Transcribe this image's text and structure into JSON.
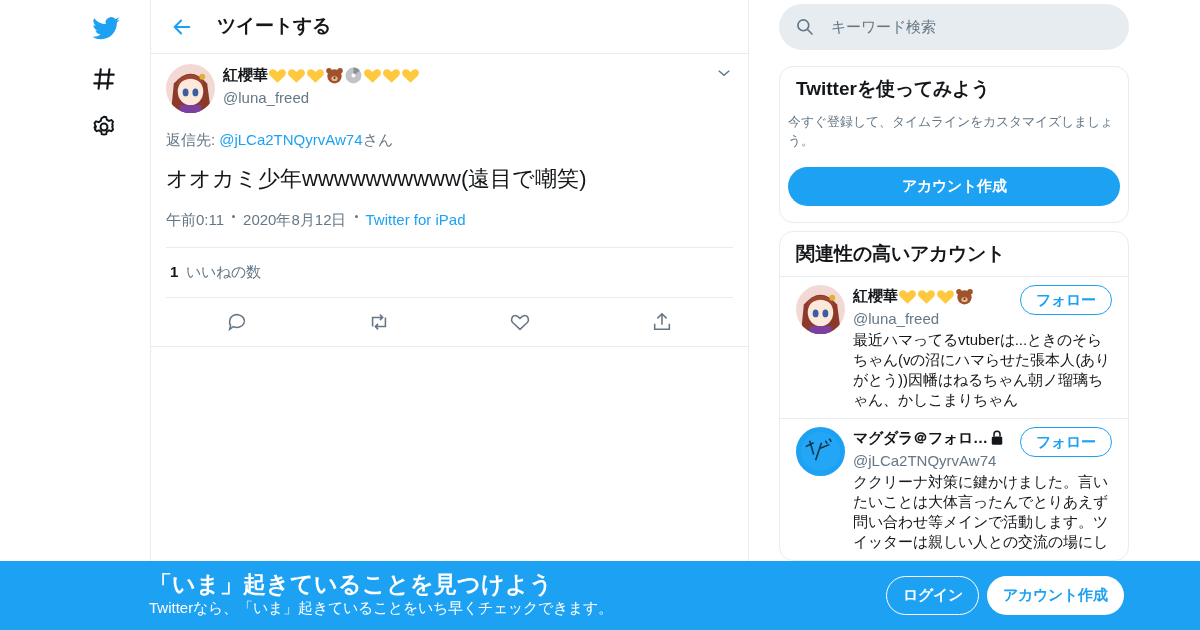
{
  "nav": [
    {
      "kind": "bird"
    },
    {
      "kind": "hash"
    },
    {
      "kind": "gear"
    }
  ],
  "header": {
    "title": "ツイートする"
  },
  "tweet": {
    "name": "紅櫻華",
    "handle": "@luna_freed",
    "reply_label": "返信先:",
    "reply_to": "@jLCa2TNQyrvAw74",
    "reply_suffix": "さん",
    "text": "オオカミ少年wwwwwwwwww(遠目で嘲笑)",
    "time": "午前0:11",
    "date": "2020年8月12日",
    "source": "Twitter for iPad",
    "likes_count": "1",
    "likes_label": "いいねの数"
  },
  "search": {
    "placeholder": "キーワード検索"
  },
  "signup_card": {
    "title": "Twitterを使ってみよう",
    "text": "今すぐ登録して、タイムラインをカスタマイズしましょう。",
    "button": "アカウント作成"
  },
  "related": {
    "title": "関連性の高いアカウント",
    "accounts": [
      {
        "name": "紅櫻華",
        "handle": "@luna_freed",
        "locked": false,
        "follow": "フォロー",
        "bio": "最近ハマってるvtuberは...ときのそらちゃん(vの沼にハマらせた張本人(ありがとう))因幡はねるちゃん朝ノ瑠璃ちゃん、かしこまりちゃん"
      },
      {
        "name": "マグダラ＠フォロ…",
        "handle": "@jLCa2TNQyrvAw74",
        "locked": true,
        "follow": "フォロー",
        "bio": "ククリーナ対策に鍵かけました。言いたいことは大体言ったんでとりあえず問い合わせ等メインで活動します。ツイッターは親しい人との交流の場にし"
      }
    ]
  },
  "banner": {
    "title": "「いま」起きていることを見つけよう",
    "subtitle": "Twitterなら、「いま」起きていることをいち早くチェックできます。",
    "login": "ログイン",
    "signup": "アカウント作成"
  }
}
